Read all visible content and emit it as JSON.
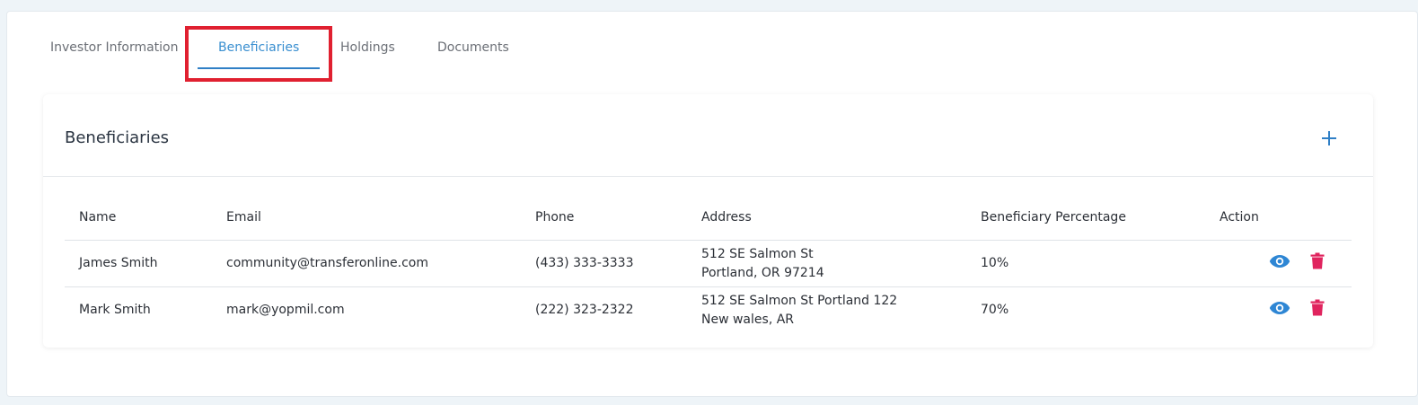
{
  "tabs": [
    {
      "label": "Investor Information",
      "active": false
    },
    {
      "label": "Beneficiaries",
      "active": true
    },
    {
      "label": "Holdings",
      "active": false
    },
    {
      "label": "Documents",
      "active": false
    }
  ],
  "card": {
    "title": "Beneficiaries",
    "add_icon": "plus-icon"
  },
  "table": {
    "headers": [
      "Name",
      "Email",
      "Phone",
      "Address",
      "Beneficiary Percentage",
      "Action"
    ],
    "rows": [
      {
        "name": "James Smith",
        "email": "community@transferonline.com",
        "phone": "(433) 333-3333",
        "address_line1": "512 SE Salmon St",
        "address_line2": "Portland, OR 97214",
        "percentage": "10%"
      },
      {
        "name": "Mark Smith",
        "email": "mark@yopmil.com",
        "phone": "(222) 323-2322",
        "address_line1": "512 SE Salmon St Portland 122",
        "address_line2": "New wales, AR",
        "percentage": "70%"
      }
    ]
  },
  "colors": {
    "accent": "#2f7fc6",
    "view_icon": "#2e86d4",
    "delete_icon": "#e0245e",
    "highlight": "#e02030"
  }
}
